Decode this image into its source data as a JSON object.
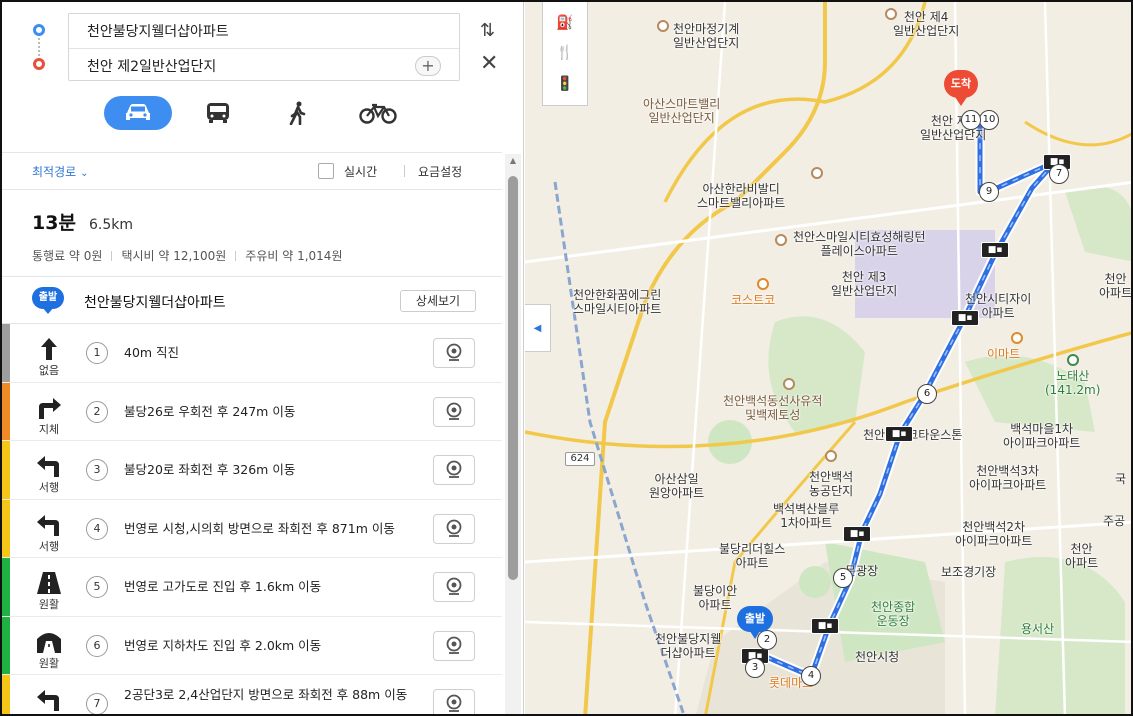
{
  "route": {
    "origin": "천안불당지웰더샵아파트",
    "destination": "천안 제2일반산업단지",
    "add_waypoint": "+"
  },
  "modes": [
    {
      "name": "car",
      "active": true
    },
    {
      "name": "transit",
      "active": false
    },
    {
      "name": "walk",
      "active": false
    },
    {
      "name": "bike",
      "active": false
    }
  ],
  "options": {
    "route_type": "최적경로",
    "realtime_label": "실시간",
    "fee_settings": "요금설정"
  },
  "summary": {
    "time": "13분",
    "distance": "6.5km",
    "toll": "통행료 약 0원",
    "taxi": "택시비 약 12,100원",
    "fuel": "주유비 약 1,014원"
  },
  "start": {
    "badge": "출발",
    "name": "천안불당지웰더샵아파트",
    "detail_button": "상세보기"
  },
  "steps": [
    {
      "num": "1",
      "icon": "straight-arrow-icon",
      "traffic": "없음",
      "traffic_color": "#9e9e9e",
      "text": "40m 직진"
    },
    {
      "num": "2",
      "icon": "turn-right-icon",
      "traffic": "지체",
      "traffic_color": "#f08a24",
      "text": "불당26로 우회전 후 247m 이동"
    },
    {
      "num": "3",
      "icon": "turn-left-icon",
      "traffic": "서행",
      "traffic_color": "#f5c518",
      "text": "불당20로 좌회전 후 326m 이동"
    },
    {
      "num": "4",
      "icon": "turn-left-icon",
      "traffic": "서행",
      "traffic_color": "#f5c518",
      "text": "번영로 시청,시의회 방면으로 좌회전 후 871m 이동"
    },
    {
      "num": "5",
      "icon": "road-icon",
      "traffic": "원활",
      "traffic_color": "#1fb141",
      "text": "번영로 고가도로 진입 후 1.6km 이동"
    },
    {
      "num": "6",
      "icon": "tunnel-icon",
      "traffic": "원활",
      "traffic_color": "#1fb141",
      "text": "번영로 지하차도 진입 후 2.0km 이동"
    },
    {
      "num": "7",
      "icon": "turn-left-icon",
      "traffic": "",
      "traffic_color": "#f5c518",
      "text": "2공단3로 2,4산업단지 방면으로 좌회전 후 88m 이동"
    }
  ],
  "map": {
    "labels": {
      "l1": "천안마정기계\n일반산업단지",
      "l2": "천안 제4\n일반산업단지",
      "l3": "아산스마트밸리\n일반산업단지",
      "l4": "천안 제2\n일반산업단지",
      "l5": "아산한라비발디\n스마트밸리아파트",
      "l6": "천안스마일시티효성해링턴\n플레이스아파트",
      "l7": "천안 제3\n일반산업단지",
      "l8": "천안한화꿈에그린\n스마일시티아파트",
      "l9": "코스트코",
      "l10": "천안시티자이\n아파트",
      "l11": "이마트",
      "l12": "노태산\n(141.2m)",
      "l13": "천안백석동선사유적\n및백제토성",
      "l14": "천안레이크타운스톤",
      "l15": "백석마을1차\n아이파크아파트",
      "l16": "아산삼일\n원앙아파트",
      "l17": "천안백석\n농공단지",
      "l18": "천안백석3차\n아이파크아파트",
      "l19": "백석벽산블루\n1차아파트",
      "l20": "천안백석2차\n아이파크아파트",
      "l21": "불당리더힐스\n아파트",
      "l22": "보조경기장",
      "l23": "천안종합\n운동장",
      "l24": "천안불당지웰\n더샵아파트",
      "l25": "천안시청",
      "l26": "불당이안\n아파트",
      "l27": "천안\n아파트",
      "l28": "주공",
      "l29": "천안\n아파트",
      "l30": "용서산",
      "l31": "롯데마트",
      "l32": "문광장",
      "l33": "국"
    },
    "road_shield": "624",
    "dest_badge": "도착",
    "origin_badge": "출발",
    "route_color": "#2f6fe0"
  }
}
